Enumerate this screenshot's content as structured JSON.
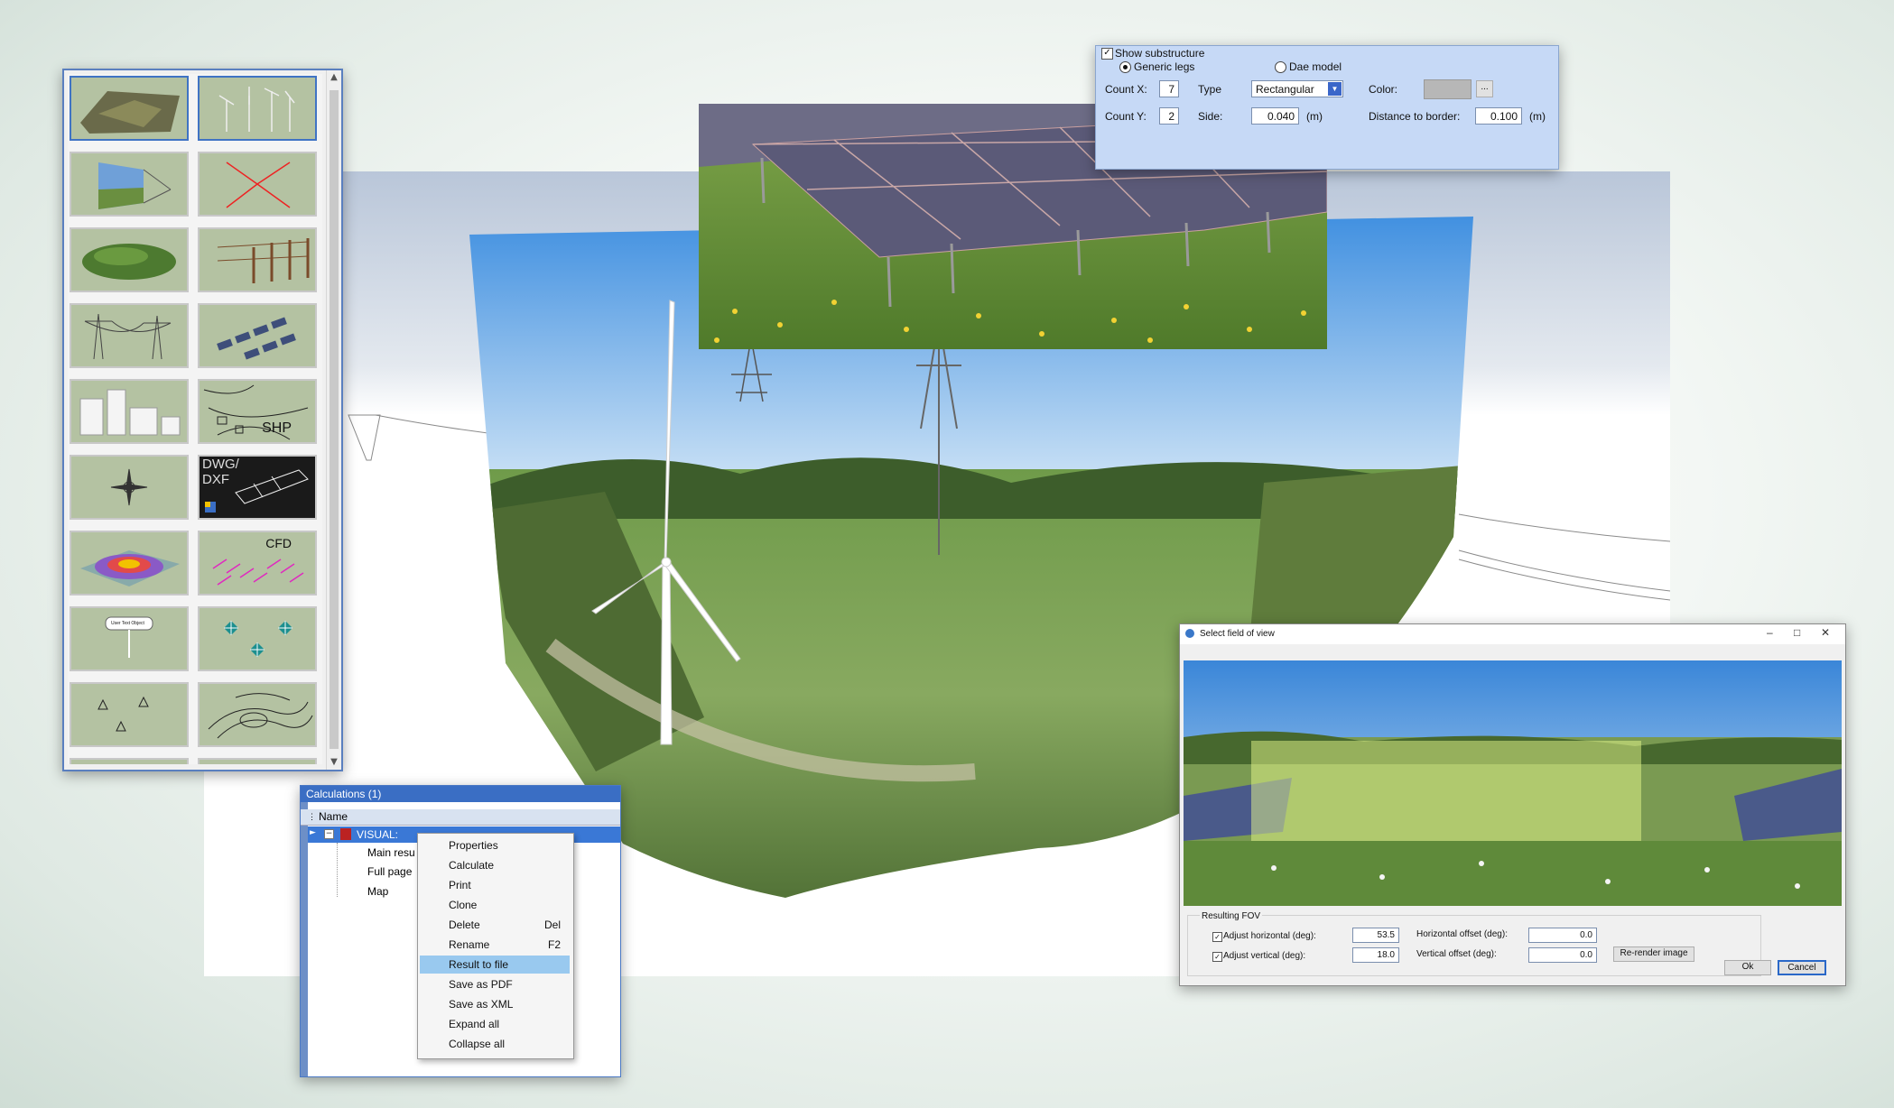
{
  "palette": {
    "tiles": [
      {
        "name": "terrain"
      },
      {
        "name": "wind-turbines"
      },
      {
        "name": "photomontage"
      },
      {
        "name": "directions"
      },
      {
        "name": "forest-area"
      },
      {
        "name": "fence"
      },
      {
        "name": "power-lines"
      },
      {
        "name": "solar-panels"
      },
      {
        "name": "buildings"
      },
      {
        "name": "shp-import",
        "label": "SHP"
      },
      {
        "name": "compass"
      },
      {
        "name": "dwg-dxf-import",
        "label": "DWG/\nDXF"
      },
      {
        "name": "heat-map"
      },
      {
        "name": "cfd-flow",
        "label": "CFD"
      },
      {
        "name": "text-object",
        "label": "User Text Object"
      },
      {
        "name": "markers"
      },
      {
        "name": "points"
      },
      {
        "name": "contour-lines"
      }
    ]
  },
  "substructure": {
    "show_label": "Show substructure",
    "generic_label": "Generic legs",
    "dae_label": "Dae model",
    "count_x_label": "Count X:",
    "count_x": "7",
    "type_label": "Type",
    "type_value": "Rectangular",
    "color_label": "Color:",
    "color_button": "...",
    "count_y_label": "Count Y:",
    "count_y": "2",
    "side_label": "Side:",
    "side_value": "0.040",
    "side_unit": "(m)",
    "dist_label": "Distance to border:",
    "dist_value": "0.100",
    "dist_unit": "(m)"
  },
  "calculations": {
    "title": "Calculations (1)",
    "col_name": "Name",
    "root": "VISUAL:",
    "children": [
      "Main resu",
      "Full page",
      "Map"
    ]
  },
  "context_menu": {
    "items": [
      {
        "label": "Properties",
        "shortcut": ""
      },
      {
        "label": "Calculate",
        "shortcut": ""
      },
      {
        "label": "Print",
        "shortcut": ""
      },
      {
        "label": "Clone",
        "shortcut": ""
      },
      {
        "label": "Delete",
        "shortcut": "Del"
      },
      {
        "label": "Rename",
        "shortcut": "F2"
      },
      {
        "label": "Result to file",
        "shortcut": ""
      },
      {
        "label": "Save as PDF",
        "shortcut": ""
      },
      {
        "label": "Save as XML",
        "shortcut": ""
      },
      {
        "label": "Expand all",
        "shortcut": ""
      },
      {
        "label": "Collapse all",
        "shortcut": ""
      }
    ],
    "highlighted": "Result to file"
  },
  "fov_dialog": {
    "title": "Select field of view",
    "section": "Resulting FOV",
    "adj_h_label": "Adjust horizontal (deg):",
    "adj_h_value": "53.5",
    "adj_v_label": "Adjust vertical (deg):",
    "adj_v_value": "18.0",
    "h_off_label": "Horizontal offset (deg):",
    "h_off_value": "0.0",
    "v_off_label": "Vertical offset (deg):",
    "v_off_value": "0.0",
    "rerender": "Re-render image",
    "ok": "Ok",
    "cancel": "Cancel"
  },
  "colors": {
    "accent": "#3a6ec4",
    "panel": "#c6d9f6",
    "highlight": "#99c9ef"
  }
}
